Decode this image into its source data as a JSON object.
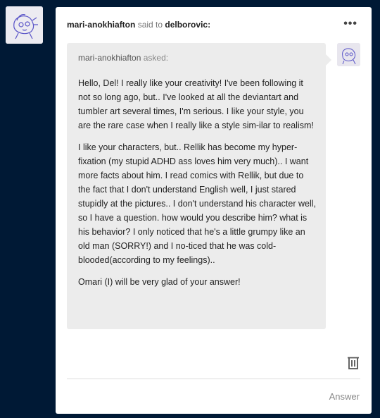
{
  "post": {
    "reblogger": "mari-anokhiafton",
    "said_to": "said to",
    "recipient": "delborovic:",
    "more_label": "•••"
  },
  "ask": {
    "asker": "mari-anokhiafton",
    "asked_label": "asked:",
    "paragraphs": [
      "Hello, Del! I really like your creativity! I've been following it not so long ago, but.. I've looked at all the deviantart and tumbler art several times, I'm serious. I like your style, you are the rare case when I really like a style sim-ilar to realism!",
      "I like your characters, but.. Rellik has become my hyper-fixation (my stupid ADHD ass loves him very much).. I want more facts about him. I read comics with Rellik, but due to the fact that I don't understand English well, I just stared stupidly at the pictures.. I don't understand his character well, so I have a question. how would you describe him? what is his behavior? I only noticed that he's a little grumpy like an old man (SORRY!) and I no-ticed that he was cold-blooded(according to my feelings)..",
      "Omari (I) will be very glad of your answer!"
    ]
  },
  "footer": {
    "answer_label": "Answer"
  },
  "icons": {
    "more": "more-icon",
    "trash": "trash-icon"
  },
  "colors": {
    "background": "#001935",
    "card": "#ffffff",
    "bubble": "#ececec"
  }
}
